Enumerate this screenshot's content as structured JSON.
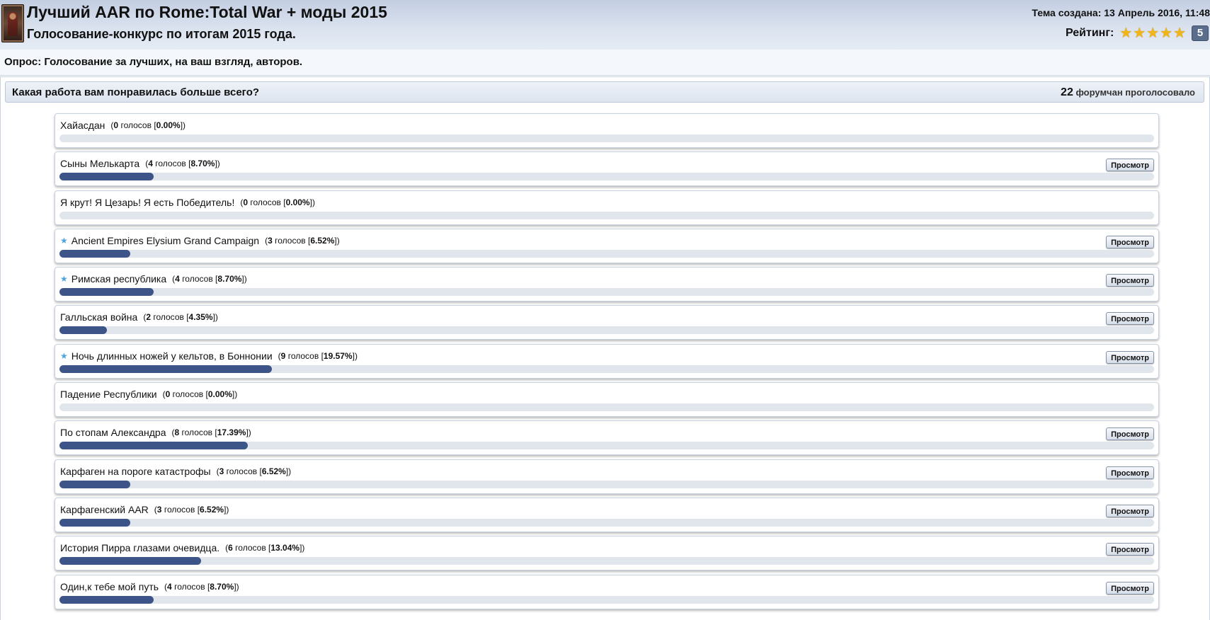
{
  "topic": {
    "title": "Лучший AAR по Rome:Total War + моды 2015",
    "description": "Голосование-конкурс по итогам 2015 года.",
    "created": "Тема создана: 13 Апрель 2016, 11:48",
    "rating_label": "Рейтинг:",
    "rating_stars": 5,
    "rating_count": "5"
  },
  "poll": {
    "title": "Опрос: Голосование за лучших, на ваш взгляд, авторов.",
    "question": "Какая работа вам понравилась больше всего?",
    "voters_count": "22",
    "voters_label": "форумчан проголосовало",
    "view_label": "Просмотр",
    "answers": [
      {
        "title": "Хайасдан",
        "votes": "0",
        "votes_word": "голосов",
        "percent": "0.00%",
        "value": 0.0,
        "starred": false,
        "has_view": false
      },
      {
        "title": "Сыны Мелькарта",
        "votes": "4",
        "votes_word": "голосов",
        "percent": "8.70%",
        "value": 8.7,
        "starred": false,
        "has_view": true
      },
      {
        "title": "Я крут! Я Цезарь! Я есть Победитель!",
        "votes": "0",
        "votes_word": "голосов",
        "percent": "0.00%",
        "value": 0.0,
        "starred": false,
        "has_view": false
      },
      {
        "title": "Ancient Empires Elysium Grand Campaign",
        "votes": "3",
        "votes_word": "голосов",
        "percent": "6.52%",
        "value": 6.52,
        "starred": true,
        "has_view": true
      },
      {
        "title": "Римская республика",
        "votes": "4",
        "votes_word": "голосов",
        "percent": "8.70%",
        "value": 8.7,
        "starred": true,
        "has_view": true
      },
      {
        "title": "Галльская война",
        "votes": "2",
        "votes_word": "голосов",
        "percent": "4.35%",
        "value": 4.35,
        "starred": false,
        "has_view": true
      },
      {
        "title": "Ночь длинных ножей у кельтов, в Боннонии",
        "votes": "9",
        "votes_word": "голосов",
        "percent": "19.57%",
        "value": 19.57,
        "starred": true,
        "has_view": true
      },
      {
        "title": "Падение Республики",
        "votes": "0",
        "votes_word": "голосов",
        "percent": "0.00%",
        "value": 0.0,
        "starred": false,
        "has_view": false
      },
      {
        "title": "По стопам Александра",
        "votes": "8",
        "votes_word": "голосов",
        "percent": "17.39%",
        "value": 17.39,
        "starred": false,
        "has_view": true
      },
      {
        "title": "Карфаген на пороге катастрофы",
        "votes": "3",
        "votes_word": "голосов",
        "percent": "6.52%",
        "value": 6.52,
        "starred": false,
        "has_view": true
      },
      {
        "title": "Карфагенский AAR",
        "votes": "3",
        "votes_word": "голосов",
        "percent": "6.52%",
        "value": 6.52,
        "starred": false,
        "has_view": true
      },
      {
        "title": "История Пирра глазами очевидца.",
        "votes": "6",
        "votes_word": "голосов",
        "percent": "13.04%",
        "value": 13.04,
        "starred": false,
        "has_view": true
      },
      {
        "title": "Один,к тебе мой путь",
        "votes": "4",
        "votes_word": "голосов",
        "percent": "8.70%",
        "value": 8.7,
        "starred": false,
        "has_view": true
      }
    ]
  },
  "colors": {
    "bar_fill": "#3d5488",
    "bar_track": "#e1e6ec",
    "star": "#f2b516",
    "fav_star": "#4ea3df"
  }
}
